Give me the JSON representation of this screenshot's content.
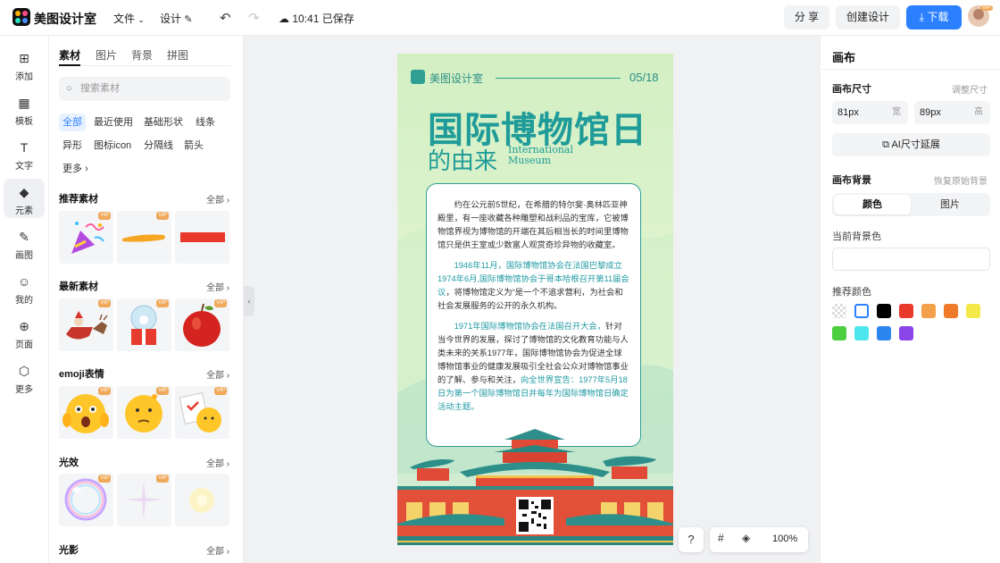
{
  "app": {
    "name": "美图设计室"
  },
  "topbar": {
    "file_menu": "文件",
    "design_menu": "设计",
    "save_status": "10:41 已保存",
    "share_label": "分 享",
    "create_label": "创建设计",
    "download_label": "下载",
    "avatar_badge": "VIP"
  },
  "leftnav": {
    "items": [
      {
        "label": "添加",
        "icon": "plus-square-icon"
      },
      {
        "label": "模板",
        "icon": "template-icon"
      },
      {
        "label": "文字",
        "icon": "text-icon"
      },
      {
        "label": "元素",
        "icon": "shapes-icon"
      },
      {
        "label": "画图",
        "icon": "pen-icon"
      },
      {
        "label": "我的",
        "icon": "user-icon"
      },
      {
        "label": "页面",
        "icon": "page-add-icon"
      },
      {
        "label": "更多",
        "icon": "cube-icon"
      }
    ],
    "active_index": 3
  },
  "panel": {
    "tabs": [
      "素材",
      "图片",
      "背景",
      "拼图"
    ],
    "search_placeholder": "搜索素材",
    "chips": [
      "全部",
      "最近使用",
      "基础形状",
      "线条",
      "异形",
      "图标icon",
      "分隔线",
      "箭头",
      "更多"
    ],
    "sections": [
      {
        "title": "推荐素材",
        "all": "全部"
      },
      {
        "title": "最新素材",
        "all": "全部"
      },
      {
        "title": "emoji表情",
        "all": "全部"
      },
      {
        "title": "光效",
        "all": "全部"
      },
      {
        "title": "光影",
        "all": "全部"
      }
    ],
    "vip_badge": "VIP"
  },
  "poster": {
    "brand": "美图设计室",
    "date": "05/18",
    "title": "国际博物馆日",
    "subtitle": "的由来",
    "en_line1": "International",
    "en_line2": "Museum",
    "para1": "约在公元前5世纪，在希腊的特尔斐·奥林匹亚神殿里，有一座收藏各种雕塑和战利品的宝库，它被博物馆界视为博物馆的开端在其后相当长的时间里博物馆只是供王室或少数富人观赏奇珍异物的收藏室。",
    "para2_hl1": "1946年11月，国际博物馆协会在法国巴黎成立1974年6月,",
    "para2_hl2": "国际博物馆协会于哥本哈根召开第11届会议",
    "para2_rest": "，将博物馆定义为“是一个不追求营利，为社会和社会发展服务的公开的永久机构。",
    "para3_hl1": "1971年国际博物馆协会在法国召开大会，",
    "para3_rest": "针对当今世界的发展，探讨了博物馆的文化教育功能与人类未来的关系1977年，国际博物馆协会为促进全球博物馆事业的健康发展吸引全社会公众对博物馆事业的了解、参与和关注，",
    "para3_hl2": "向全世界宣告：1977年5月18日为第一个国际博物馆日并每年为国际博物馆日确定活动主题。"
  },
  "zoom": {
    "value": "100%",
    "help": "?"
  },
  "right": {
    "title": "画布",
    "size_label": "画布尺寸",
    "size_hint": "调整尺寸",
    "width_value": "81px",
    "width_unit": "宽",
    "height_value": "89px",
    "height_unit": "高",
    "ai_button": "AI尺寸延展",
    "bg_label": "画布背景",
    "bg_hint": "恢复原始背景",
    "seg_color": "颜色",
    "seg_image": "图片",
    "current_bg_label": "当前背景色",
    "recommend_label": "推荐颜色",
    "swatches": [
      "transparent",
      "#ffffff",
      "#000000",
      "#e8392b",
      "#f2a04a",
      "#ef7a2a",
      "#f5e94a",
      "#4ccf3f",
      "#4de6ec",
      "#2b86ef",
      "#8a45e8"
    ]
  }
}
